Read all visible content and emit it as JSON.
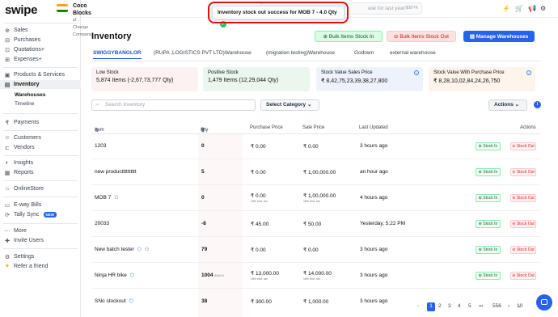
{
  "app": {
    "logo": "swipe",
    "company_name": "Coco Blocks",
    "company_sub": "⇄ Change Company"
  },
  "colors": {
    "accent": "#2563eb",
    "stock_in": "#22c55e",
    "stock_out": "#dc2626",
    "toast_border": "#e01010"
  },
  "topbar": {
    "search_placeholder": "ask for last year?",
    "shortcut": "ctrl+k"
  },
  "toast": {
    "message": "Inventory stock out success for MOB 7 - 4.0 Qty",
    "icon": "check-circle-icon"
  },
  "sidebar": {
    "items": [
      {
        "label": "Sales",
        "icon": "cart-icon"
      },
      {
        "label": "Purchases",
        "icon": "bag-icon"
      },
      {
        "label": "Quotations+",
        "icon": "quote-icon"
      },
      {
        "label": "Expenses+",
        "icon": "receipt-icon"
      },
      {
        "label": "Products & Services",
        "icon": "box-icon"
      },
      {
        "label": "Inventory",
        "icon": "inventory-icon"
      },
      {
        "label": "Warehouses"
      },
      {
        "label": "Timeline"
      },
      {
        "label": "Payments",
        "icon": "rupee-icon"
      },
      {
        "label": "Customers",
        "icon": "user-icon"
      },
      {
        "label": "Vendors",
        "icon": "truck-icon"
      },
      {
        "label": "Insights",
        "icon": "insights-icon"
      },
      {
        "label": "Reports",
        "icon": "report-icon"
      },
      {
        "label": "OnlineStore",
        "icon": "store-icon"
      },
      {
        "label": "E-way Bills",
        "icon": "bill-icon"
      },
      {
        "label": "Tally Sync",
        "icon": "sync-icon",
        "badge": "NEW"
      },
      {
        "label": "More",
        "icon": "more-icon"
      },
      {
        "label": "Invite Users",
        "icon": "invite-icon"
      },
      {
        "label": "Settings",
        "icon": "settings-icon"
      },
      {
        "label": "Refer a friend",
        "icon": "gift-icon"
      }
    ]
  },
  "page": {
    "title": "Inventory"
  },
  "buttons": {
    "bulk_in": "Bulk Items Stock In",
    "bulk_out": "Bulk Items Stock Out",
    "manage": "Manage Warehouses"
  },
  "tabs": [
    "SWIGGYBANGLOR",
    "(RUPA ,LOGISTICS PVT LTD)Warehouse",
    "(migration testing)Warehouse",
    "Godown",
    "external warehouse"
  ],
  "cards": [
    {
      "label": "Low Stock",
      "value": "5,874 Items (-2,67,73,777 Qty)"
    },
    {
      "label": "Positive Stock",
      "value": "1,479 Items (12,29,044 Qty)"
    },
    {
      "label": "Stock Value Sales Price",
      "value": "₹ 8,42,75,23,39,38,27,800"
    },
    {
      "label": "Stock Value With Purchase Price",
      "value": "₹ 8,28,10,02,84,24,26,750"
    }
  ],
  "filters": {
    "search_placeholder": "Search Inventory",
    "category": "Select Category",
    "actions": "Actions"
  },
  "table": {
    "headers": {
      "item": "Item",
      "qty": "Qty",
      "purchase": "Purchase Price",
      "sale": "Sale Price",
      "updated": "Last Updated",
      "actions": "Actions"
    },
    "stock_in_label": "Stock In",
    "stock_out_label": "Stock Out",
    "rows": [
      {
        "item": "1203",
        "qty": "0",
        "purchase": "₹ 0.00",
        "sale": "₹ 0.00",
        "updated": "3 hours ago"
      },
      {
        "item": "new productttttttttt",
        "qty": "5",
        "purchase": "₹ 0.00",
        "sale": "₹ 1,00,000.00",
        "updated": "an hour ago"
      },
      {
        "item": "MOB 7",
        "qty": "0",
        "purchase": "₹ 0.00",
        "purchase_tax": "18% excl. tax",
        "sale": "₹ 1,00,000.00",
        "sale_tax": "18% excl. tax",
        "updated": "4 hours ago"
      },
      {
        "item": "20033",
        "qty": "-8",
        "purchase": "₹ 45.00",
        "sale": "₹ 50.00",
        "updated": "Yesterday, 5:22 PM"
      },
      {
        "item": "New batch tester",
        "qty": "79",
        "purchase": "₹ 0.00",
        "sale": "₹ 0.00",
        "updated": "3 hours ago"
      },
      {
        "item": "Ninja HR bike",
        "qty": "1004",
        "unit": "EACH",
        "purchase": "₹ 13,000.00",
        "purchase_tax": "18% excl. tax",
        "sale": "₹ 14,000.00",
        "sale_tax": "18% excl. tax",
        "updated": "3 hours ago"
      },
      {
        "item": "SNo stockout",
        "qty": "38",
        "purchase": "₹ 300.00",
        "sale": "₹ 1,000.00",
        "updated": "3 hours ago"
      }
    ]
  },
  "pagination": {
    "pages": [
      "1",
      "2",
      "3",
      "4",
      "5",
      "•••",
      "556"
    ],
    "page_size": "10"
  }
}
